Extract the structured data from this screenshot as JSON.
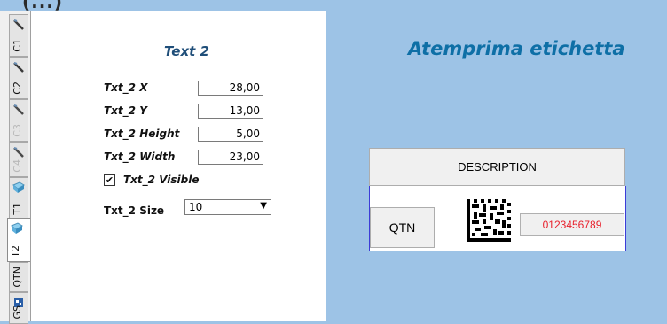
{
  "window": {
    "clipped_title": "_ (...)"
  },
  "tabs": [
    {
      "id": "c1",
      "label": "C1",
      "icon": "pen-icon",
      "enabled": true
    },
    {
      "id": "c2",
      "label": "C2",
      "icon": "pen-icon",
      "enabled": true
    },
    {
      "id": "c3",
      "label": "C3",
      "icon": "pen-icon",
      "enabled": false
    },
    {
      "id": "c4",
      "label": "C4",
      "icon": "pen-icon",
      "enabled": false
    },
    {
      "id": "t1",
      "label": "T1",
      "icon": "text-block-icon",
      "enabled": true
    },
    {
      "id": "t2",
      "label": "T2",
      "icon": "text-block-icon",
      "enabled": true,
      "active": true
    },
    {
      "id": "qtn",
      "label": "QTN",
      "icon": "",
      "enabled": true
    },
    {
      "id": "gs",
      "label": "GS",
      "icon": "barcode-icon",
      "enabled": true
    }
  ],
  "panel": {
    "title": "Text 2",
    "fields": [
      {
        "label": "Txt_2 X",
        "value": "28,00"
      },
      {
        "label": "Txt_2 Y",
        "value": "13,00"
      },
      {
        "label": "Txt_2 Height",
        "value": "5,00"
      },
      {
        "label": "Txt_2 Width",
        "value": "23,00"
      }
    ],
    "visible": {
      "label": "Txt_2 Visible",
      "checked": true,
      "mark": "✔"
    },
    "size": {
      "label": "Txt_2 Size",
      "value": "10"
    }
  },
  "preview": {
    "title": "Atemprima etichetta",
    "description_label": "DESCRIPTION",
    "qtn_label": "QTN",
    "serial_number": "0123456789",
    "serial_color": "#e8202c"
  },
  "colors": {
    "background": "#9dc3e6",
    "title": "#0e6fa6",
    "panel_title": "#1f4e79"
  }
}
